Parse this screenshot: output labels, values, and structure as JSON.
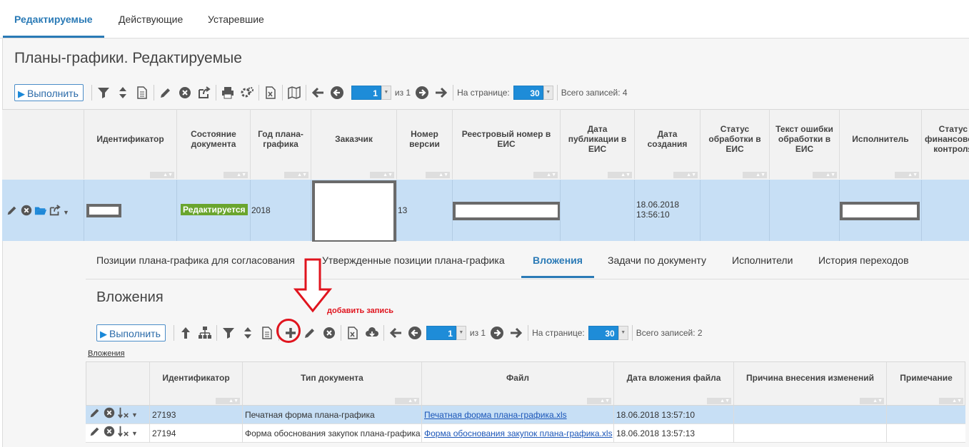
{
  "top_tabs": [
    "Редактируемые",
    "Действующие",
    "Устаревшие"
  ],
  "page_title": "Планы-графики. Редактируемые",
  "toolbar": {
    "run_label": "Выполнить",
    "page_value": "1",
    "page_of": "из 1",
    "per_page_label": "На странице:",
    "per_page_value": "30",
    "total_label": "Всего записей: 4"
  },
  "columns": [
    "Идентификатор",
    "Состояние документа",
    "Год плана-графика",
    "Заказчик",
    "Номер версии",
    "Реестровый номер в ЕИС",
    "Дата публикации в ЕИС",
    "Дата создания",
    "Статус обработки в ЕИС",
    "Текст ошибки обработки в ЕИС",
    "Исполнитель",
    "Статус финансового контроля"
  ],
  "row": {
    "status": "Редактируется",
    "year": "2018",
    "version": "13",
    "created": "18.06.2018 13:56:10"
  },
  "sub_tabs": [
    "Позиции плана-графика для согласования",
    "Утвержденные позиции плана-графика",
    "Вложения",
    "Задачи по документу",
    "Исполнители",
    "История переходов"
  ],
  "attachments": {
    "title": "Вложения",
    "annotation": "добавить запись",
    "run_label": "Выполнить",
    "page_value": "1",
    "page_of": "из 1",
    "per_page_label": "На странице:",
    "per_page_value": "30",
    "total_label": "Всего записей: 2",
    "breadcrumb": "Вложения",
    "columns": [
      "Идентификатор",
      "Тип документа",
      "Файл",
      "Дата вложения файла",
      "Причина внесения изменений",
      "Примечание"
    ],
    "rows": [
      {
        "id": "27193",
        "type": "Печатная форма плана-графика",
        "file": "Печатная форма плана-графика.xls",
        "date": "18.06.2018 13:57:10"
      },
      {
        "id": "27194",
        "type": "Форма обоснования закупок плана-графика",
        "file": "Форма обоснования закупок плана-графика.xls",
        "date": "18.06.2018 13:57:13"
      }
    ]
  },
  "colors": {
    "accent": "#2a7ab6",
    "row_selected": "#c7dff5",
    "badge": "#6aa52e",
    "annotation": "#e0141e"
  }
}
